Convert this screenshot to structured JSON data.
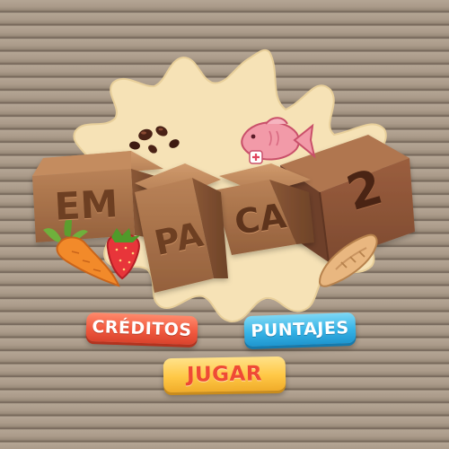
{
  "logo": {
    "box1": "EM",
    "box2": "PA",
    "box3": "CA",
    "box4": "2"
  },
  "menu": {
    "creditos_label": "CRÉDITOS",
    "puntajes_label": "PUNTAJES",
    "jugar_label": "JUGAR"
  },
  "icons": {
    "fish": "fish-icon",
    "carrot": "carrot-icon",
    "strawberry": "strawberry-icon",
    "bread": "bread-icon",
    "beans": "beans-icon"
  },
  "colors": {
    "creditos": "#f1593f",
    "puntajes": "#36b3e6",
    "jugar": "#ffc846",
    "jugar_text": "#ef4a35",
    "box": "#a26b45"
  }
}
